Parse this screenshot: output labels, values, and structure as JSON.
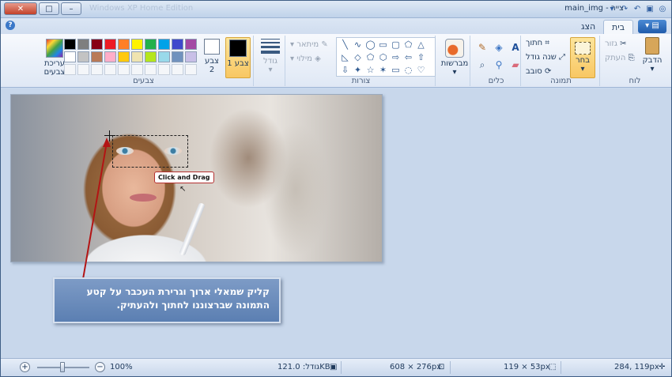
{
  "titlebar": {
    "ghost_title": "Windows XP Home Edition",
    "title": "צייר - main_img"
  },
  "tabs": {
    "home": "בית",
    "view": "הצג"
  },
  "ribbon": {
    "clipboard": {
      "label": "לוח",
      "paste": "הדבק",
      "cut": "גזור",
      "copy": "העתק"
    },
    "image": {
      "label": "תמונה",
      "select": "בחר",
      "crop": "חתוך",
      "resize": "שנה גודל",
      "rotate": "סובב"
    },
    "tools": {
      "label": "כלים"
    },
    "brushes": {
      "label": "מברשות"
    },
    "shapes": {
      "label": "צורות",
      "outline": "מיתאר",
      "fill": "מילוי"
    },
    "size": {
      "label": "גודל"
    },
    "colors": {
      "label": "צבעים",
      "color1": "צבע 1",
      "color2": "צבע 2",
      "edit": "עריכת צבעים",
      "palette": [
        "#000000",
        "#7f7f7f",
        "#880015",
        "#ed1c24",
        "#ff7f27",
        "#fff200",
        "#22b14c",
        "#00a2e8",
        "#3f48cc",
        "#a349a4",
        "#ffffff",
        "#c3c3c3",
        "#b97a57",
        "#ffaec9",
        "#ffc90e",
        "#efe4b0",
        "#b5e61d",
        "#99d9ea",
        "#7092be",
        "#c8bfe7"
      ]
    }
  },
  "canvas": {
    "tooltip": "Click and Drag",
    "callout_line1": "קליק שמאלי ארוך וגרירת העכבר על קטע",
    "callout_line2": "התמונה שברצוננו לחתוך ולהעתיק."
  },
  "statusbar": {
    "cursor_pos": "284, 119px",
    "selection_size": "119 × 53px",
    "image_size": "608 × 276px",
    "file_size": "גודל: 121.0KB",
    "zoom": "100%"
  }
}
